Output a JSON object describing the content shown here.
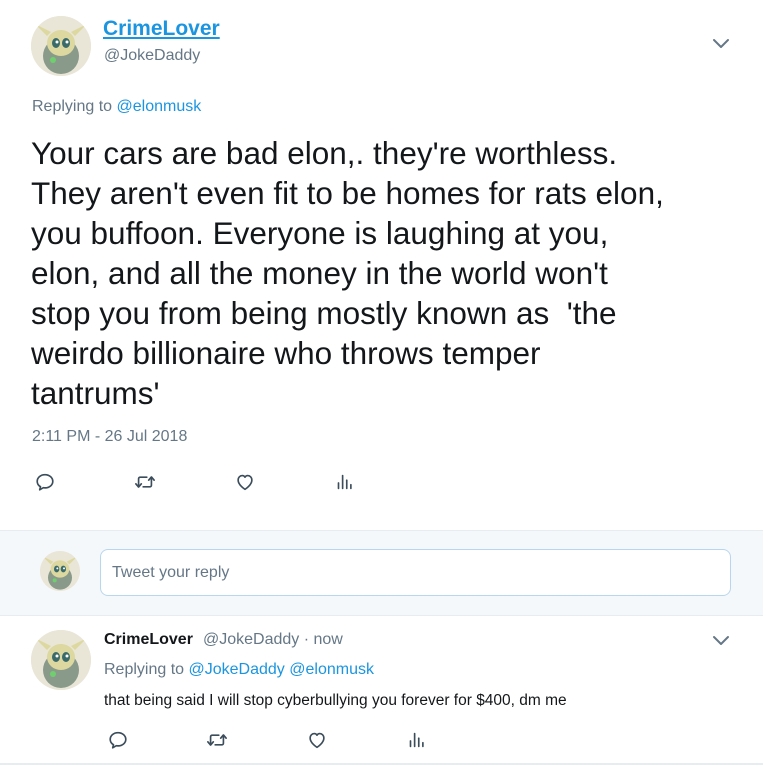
{
  "tweet": {
    "display_name": "CrimeLover",
    "handle": "@JokeDaddy",
    "replying_prefix": "Replying to",
    "replying_to": "@elonmusk",
    "text": "Your cars are bad elon,. they're worthless.\nThey aren't even fit to be homes for rats elon,\nyou buffoon. Everyone is laughing at you,\nelon, and all the money in the world won't\nstop you from being mostly known as  'the\nweirdo billionaire who throws temper\ntantrums'",
    "timestamp": "2:11 PM - 26 Jul 2018"
  },
  "reply_box": {
    "placeholder": "Tweet your reply"
  },
  "reply": {
    "display_name": "CrimeLover",
    "meta": "@JokeDaddy · now",
    "replying_prefix": "Replying to",
    "replying_to_1": "@JokeDaddy",
    "replying_to_2": "@elonmusk",
    "text": "that being said I will stop cyberbullying you forever for $400, dm me"
  },
  "icons": {
    "reply": "reply-icon",
    "retweet": "retweet-icon",
    "like": "heart-icon",
    "analytics": "analytics-icon",
    "menu": "chevron-down-icon"
  },
  "colors": {
    "link": "#1b95e0",
    "secondary_text": "#657786",
    "primary_text": "#14171a",
    "background_alt": "#f5f8fa"
  }
}
